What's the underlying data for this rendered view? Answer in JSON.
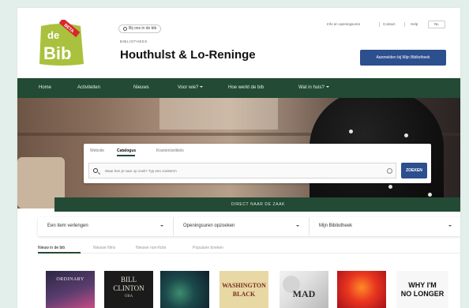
{
  "header": {
    "logo": {
      "top": "de",
      "bottom": "Bib",
      "badge": "BETA",
      "green": "#a9c13d",
      "red": "#d7272d"
    },
    "pill_label": "Bij ons in de bib",
    "subtitle": "BIBLIOTHEEK",
    "title": "Houthulst & Lo-Reninge",
    "util_links": [
      "Info en openingsuren",
      "Contact",
      "Help"
    ],
    "lang": "NL",
    "login_button": "Aanmelden bij Mijn Bibliotheek"
  },
  "nav": {
    "items": [
      {
        "label": "Home",
        "dropdown": false
      },
      {
        "label": "Activiteiten",
        "dropdown": false
      },
      {
        "label": "Nieuws",
        "dropdown": false
      },
      {
        "label": "Voor wie?",
        "dropdown": true
      },
      {
        "label": "Hoe werkt de bib",
        "dropdown": false
      },
      {
        "label": "Wat in huis?",
        "dropdown": true
      }
    ],
    "color": "#224a34"
  },
  "search": {
    "tabs": [
      "Website",
      "Catalogus",
      "Kranten/artikels"
    ],
    "active_tab": "Catalogus",
    "placeholder": "Waar ben je naar op zoek? Typ een zoekterm",
    "button": "ZOEKEN"
  },
  "direct_bar": "DIRECT NAAR DE ZAAK",
  "selects": [
    "Een item verlengen",
    "Openingsuren opzoeken",
    "Mijn Bibliotheek"
  ],
  "content_tabs": [
    "Nieuw in de bib",
    "Nieuwe films",
    "Nieuwe non-fictie",
    "Populaire boeken"
  ],
  "content_active": "Nieuw in de bib",
  "books": [
    {
      "title": "ORDINARY"
    },
    {
      "title_top": "BILL",
      "title_mid": "CLINTON",
      "title_bot": "ORA"
    },
    {
      "title": ""
    },
    {
      "title_top": "WASHINGTON",
      "title_bot": "BLACK"
    },
    {
      "title": "MAD"
    },
    {
      "title": ""
    },
    {
      "title_top": "WHY I'M",
      "title_bot": "NO LONGER"
    }
  ]
}
